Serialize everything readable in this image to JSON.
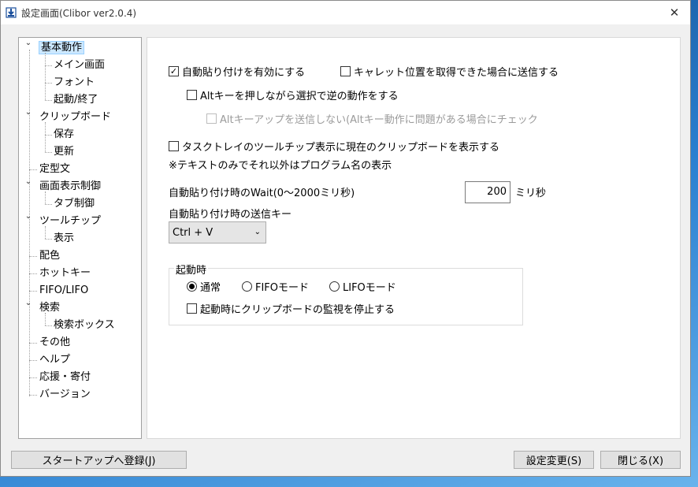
{
  "window": {
    "title": "設定画面(Clibor ver2.0.4)"
  },
  "tree": [
    {
      "label": "基本動作",
      "level": 0,
      "expanded": true,
      "selected": true
    },
    {
      "label": "メイン画面",
      "level": 1
    },
    {
      "label": "フォント",
      "level": 1
    },
    {
      "label": "起動/終了",
      "level": 1
    },
    {
      "label": "クリップボード",
      "level": 0,
      "expanded": true
    },
    {
      "label": "保存",
      "level": 1
    },
    {
      "label": "更新",
      "level": 1
    },
    {
      "label": "定型文",
      "level": 0
    },
    {
      "label": "画面表示制御",
      "level": 0,
      "expanded": true
    },
    {
      "label": "タブ制御",
      "level": 1
    },
    {
      "label": "ツールチップ",
      "level": 0,
      "expanded": true
    },
    {
      "label": "表示",
      "level": 1
    },
    {
      "label": "配色",
      "level": 0
    },
    {
      "label": "ホットキー",
      "level": 0
    },
    {
      "label": "FIFO/LIFO",
      "level": 0
    },
    {
      "label": "検索",
      "level": 0,
      "expanded": true
    },
    {
      "label": "検索ボックス",
      "level": 1
    },
    {
      "label": "その他",
      "level": 0
    },
    {
      "label": "ヘルプ",
      "level": 0
    },
    {
      "label": "応援・寄付",
      "level": 0
    },
    {
      "label": "バージョン",
      "level": 0
    }
  ],
  "options": {
    "auto_paste": {
      "label": "自動貼り付けを有効にする",
      "checked": true
    },
    "caret": {
      "label": "キャレット位置を取得できた場合に送信する",
      "checked": false
    },
    "alt_reverse": {
      "label": "Altキーを押しながら選択で逆の動作をする",
      "checked": false
    },
    "alt_keyup": {
      "label": "Altキーアップを送信しない(Altキー動作に問題がある場合にチェック",
      "checked": false,
      "disabled": true
    },
    "tasktray": {
      "label": "タスクトレイのツールチップ表示に現在のクリップボードを表示する",
      "checked": false
    },
    "note": "※テキストのみでそれ以外はプログラム名の表示"
  },
  "wait": {
    "label": "自動貼り付け時のWait(0～2000ミリ秒)",
    "value": "200",
    "unit": "ミリ秒"
  },
  "send_key": {
    "label": "自動貼り付け時の送信キー",
    "value": "Ctrl + V"
  },
  "startup_group": {
    "title": "起動時",
    "modes": [
      {
        "label": "通常",
        "selected": true
      },
      {
        "label": "FIFOモード",
        "selected": false
      },
      {
        "label": "LIFOモード",
        "selected": false
      }
    ],
    "stop_monitor": {
      "label": "起動時にクリップボードの監視を停止する",
      "checked": false
    }
  },
  "buttons": {
    "register_startup": "スタートアップへ登録(J)",
    "apply": "設定変更(S)",
    "close": "閉じる(X)"
  }
}
